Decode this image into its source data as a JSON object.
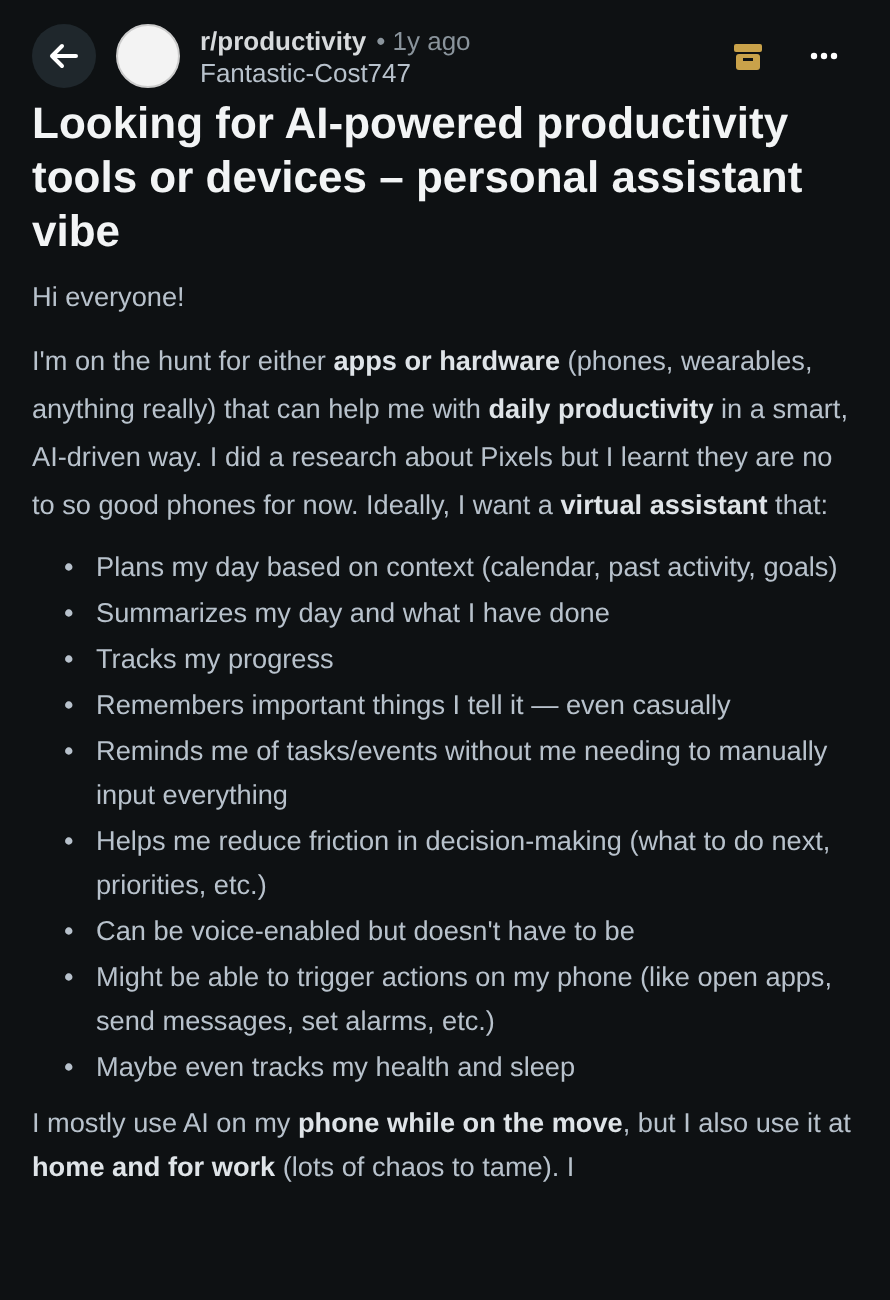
{
  "header": {
    "community": "r/productivity",
    "time": "• 1y ago",
    "author": "Fantastic-Cost747"
  },
  "post": {
    "title": "Looking for AI-powered productivity tools or devices – personal assistant vibe",
    "paragraphs_before": [
      "Hi everyone!",
      "I'm on the hunt for either **apps or hardware** (phones, wearables, anything really) that can help me with **daily productivity** in a smart, AI-driven way. I did a research about Pixels but I learnt they are no to so good phones for now. Ideally, I want a **virtual assistant** that:"
    ],
    "bullets": [
      {
        "marker": "•",
        "text": "Plans my day based on context (calendar, past activity, goals)"
      },
      {
        "marker": "•",
        "text": "Summarizes my day and what I have done"
      },
      {
        "marker": "•",
        "text": "Tracks my progress"
      },
      {
        "marker": "•",
        "text": "Remembers important things I tell it — even casually"
      },
      {
        "marker": "•",
        "text": "Reminds me of tasks/events without me needing to manually input everything"
      },
      {
        "marker": "•",
        "text": "Helps me reduce friction in decision-making (what to do next, priorities, etc.)"
      },
      {
        "marker": "•",
        "text": "Can be voice-enabled but doesn't have to be"
      },
      {
        "marker": "•",
        "text": "Might be able to trigger actions on my phone (like open apps, send messages, set alarms, etc.)"
      },
      {
        "marker": "•",
        "text": "Maybe even tracks my health and sleep"
      }
    ],
    "paragraphs_after": [
      "I mostly use AI on my **phone while on the move**, but I also use it at **home and for work** (lots of chaos to tame). I"
    ]
  }
}
